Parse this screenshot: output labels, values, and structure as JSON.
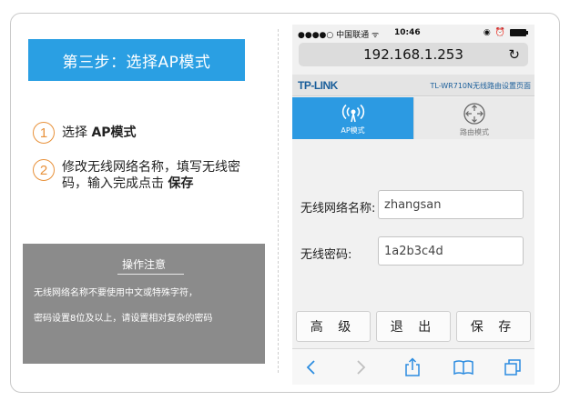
{
  "left": {
    "step_banner": "第三步：选择AP模式",
    "steps": [
      {
        "num": "1",
        "text": "选择 ",
        "bold": "AP模式"
      },
      {
        "num": "2",
        "text": "修改无线网络名称，填写无线密码，输入完成点击 ",
        "bold": "保存"
      }
    ],
    "note": {
      "title": "操作注意",
      "line1": "无线网络名称不要使用中文或特殊字符，",
      "line2": "密码设置8位及以上，请设置相对复杂的密码"
    }
  },
  "phone": {
    "status": {
      "carrier": "●●●●○ 中国联通 ",
      "time": "10:46"
    },
    "url": "192.168.1.253",
    "header": {
      "logo": "TP-LINK",
      "model": "TL-WR710N无线路由设置页面"
    },
    "tabs": [
      {
        "label": "AP模式",
        "icon": "wireless-ap-icon",
        "active": true
      },
      {
        "label": "路由模式",
        "icon": "router-icon",
        "active": false
      }
    ],
    "fields": {
      "ssid_label": "无线网络名称:",
      "ssid_value": "zhangsan",
      "password_label": "无线密码:",
      "password_value": "1a2b3c4d"
    },
    "buttons": {
      "advanced": "高 级",
      "exit": "退 出",
      "save": "保 存"
    },
    "colors": {
      "accent": "#2c9ae2",
      "banner": "#2a9fe3",
      "step_circle": "#e8913a",
      "note_bg": "#8b8b8b"
    }
  }
}
